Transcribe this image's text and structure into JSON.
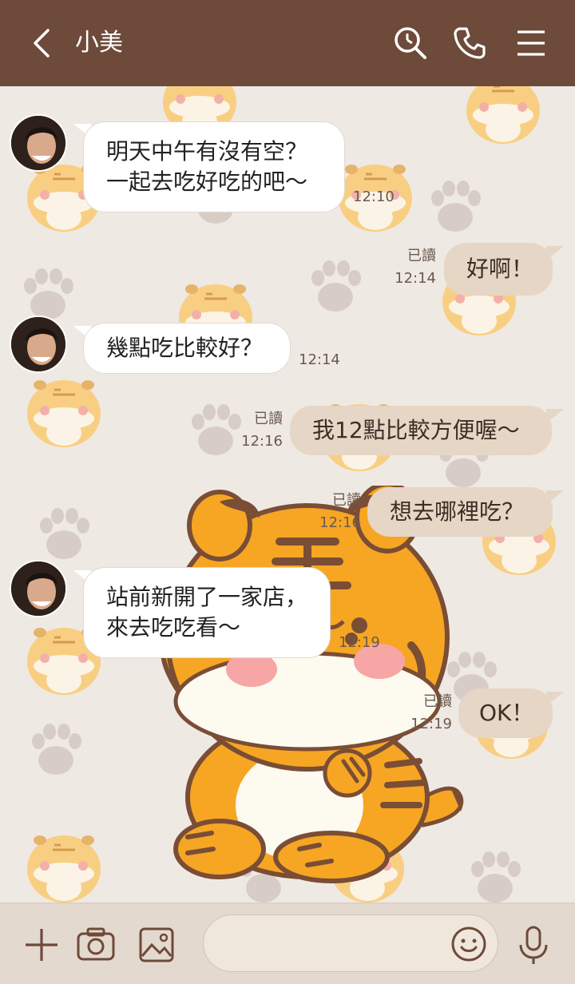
{
  "header": {
    "contact_name": "小美",
    "back_icon": "chevron-left-icon",
    "search_icon": "search-icon",
    "call_icon": "phone-icon",
    "menu_icon": "menu-icon",
    "color": "#6e4a3a"
  },
  "messages": [
    {
      "side": "in",
      "lines": [
        "明天中午有沒有空？",
        "一起去吃好吃的吧～"
      ],
      "time": "12:10"
    },
    {
      "side": "out",
      "lines": [
        "好啊！"
      ],
      "read": "已讀",
      "time": "12:14"
    },
    {
      "side": "in",
      "lines": [
        "幾點吃比較好？"
      ],
      "time": "12:14"
    },
    {
      "side": "out",
      "lines": [
        "我12點比較方便喔～"
      ],
      "read": "已讀",
      "time": "12:16"
    },
    {
      "side": "out",
      "lines": [
        "想去哪裡吃？"
      ],
      "read": "已讀",
      "time": "12:16"
    },
    {
      "side": "in",
      "lines": [
        "站前新開了一家店，",
        "來去吃吃看～"
      ],
      "time": "12:19"
    },
    {
      "side": "out",
      "lines": [
        "OK！"
      ],
      "read": "已讀",
      "time": "12:19"
    }
  ],
  "composer": {
    "placeholder": "",
    "plus_icon": "plus-icon",
    "camera_icon": "camera-icon",
    "image_icon": "image-icon",
    "emoji_icon": "smiley-icon",
    "mic_icon": "microphone-icon"
  },
  "theme": {
    "background": "#efe9e3",
    "outgoing_bubble": "#e6d6c5",
    "incoming_bubble": "#ffffff",
    "tiger_orange": "#f6a623"
  }
}
